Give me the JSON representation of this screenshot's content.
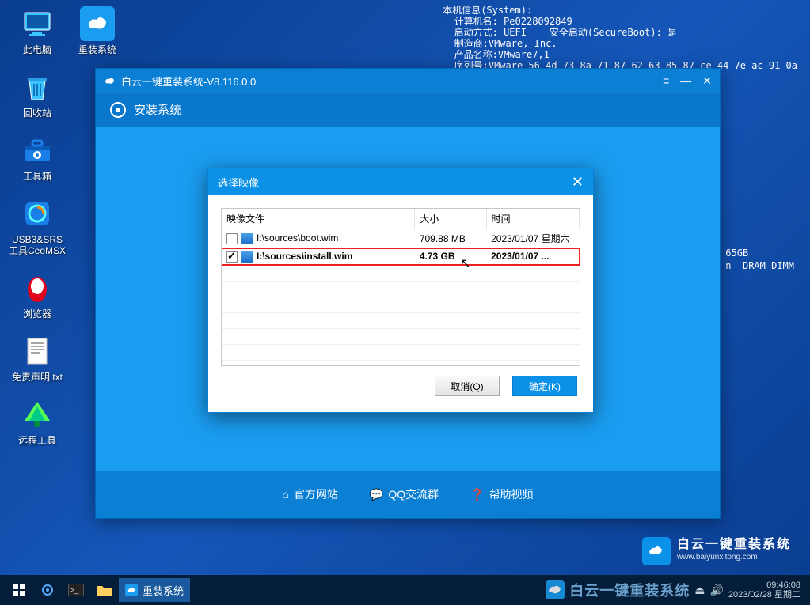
{
  "desktop": {
    "icons": [
      {
        "label": "此电脑"
      },
      {
        "label": "回收站"
      },
      {
        "label": "工具箱"
      },
      {
        "label": "USB3&SRS\n工具CeoMSX"
      },
      {
        "label": "浏览器"
      },
      {
        "label": "免责声明.txt"
      },
      {
        "label": "远程工具"
      }
    ],
    "reinstall": "重装系统"
  },
  "sysinfo": "本机信息(System):\n  计算机名: Pe0228092849\n  启动方式: UEFI    安全启动(SecureBoot): 是\n  制造商:VMware, Inc.\n  产品名称:VMware7,1\n  序列号:VMware-56 4d 73 8a 71 87 62 63-85 87 ce 44 7e ac 91 0a",
  "rightSnip": "65GB\nn  DRAM DIMM",
  "app": {
    "title": "白云一键重装系统-V8.116.0.0",
    "tab": "安装系统",
    "footer": {
      "site": "官方网站",
      "qq": "QQ交流群",
      "help": "帮助视频"
    }
  },
  "brand": {
    "cn": "白云一键重装系统",
    "url": "www.baiyunxitong.com"
  },
  "dialog": {
    "title": "选择映像",
    "cols": {
      "file": "映像文件",
      "size": "大小",
      "time": "时间"
    },
    "rows": [
      {
        "checked": false,
        "path": "I:\\sources\\boot.wim",
        "size": "709.88 MB",
        "time": "2023/01/07 星期六"
      },
      {
        "checked": true,
        "path": "I:\\sources\\install.wim",
        "size": "4.73 GB",
        "time": "2023/01/07 ..."
      }
    ],
    "cancel": "取消(Q)",
    "ok": "确定(K)"
  },
  "taskbar": {
    "active": "重装系统",
    "bigbrand": "白云一键重装系统",
    "time": "09:46:08",
    "date": "2023/02/28 星期二"
  }
}
